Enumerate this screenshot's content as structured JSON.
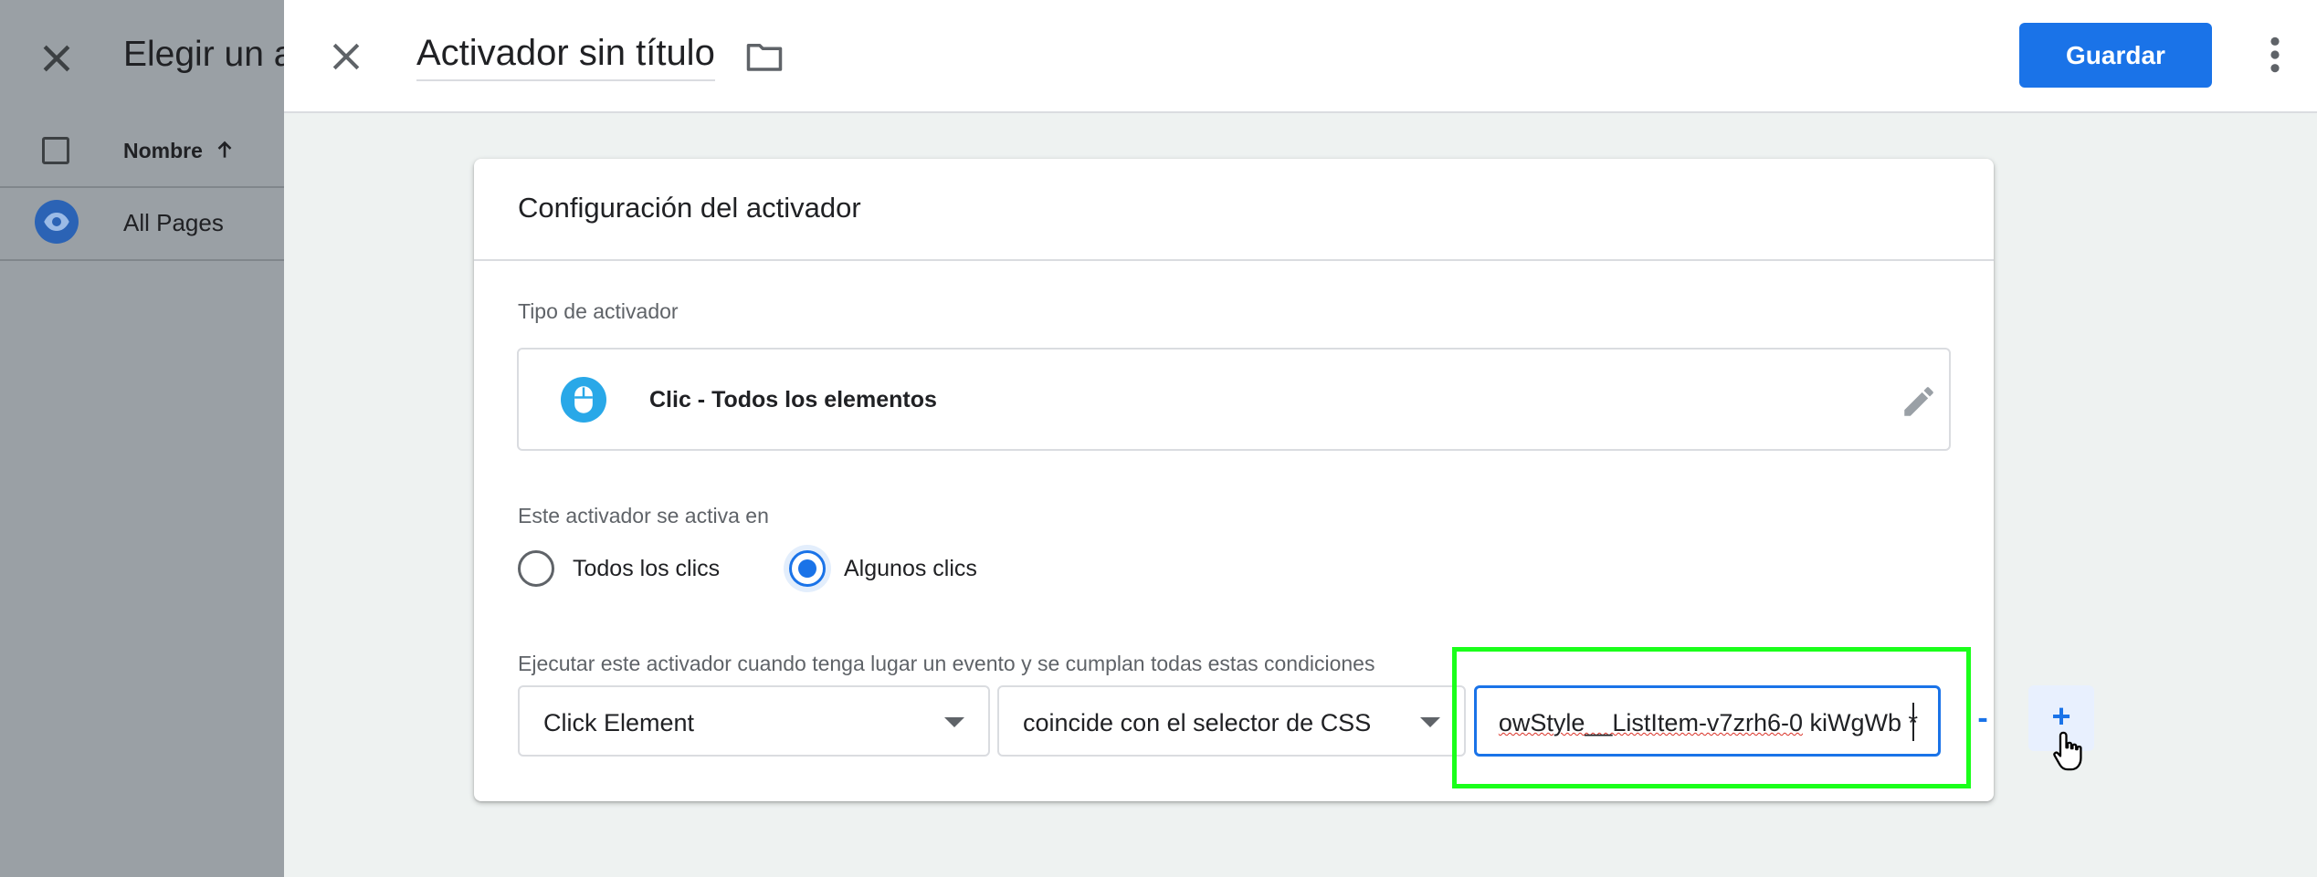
{
  "background_panel": {
    "title": "Elegir un a",
    "column_header": "Nombre",
    "rows": [
      {
        "label": "All Pages"
      }
    ]
  },
  "editor": {
    "trigger_name": "Activador sin título",
    "save_label": "Guardar"
  },
  "config": {
    "title": "Configuración del activador",
    "type_section_label": "Tipo de activador",
    "trigger_type": "Clic - Todos los elementos",
    "fires_on_label": "Este activador se activa en",
    "radio_options": [
      {
        "label": "Todos los clics",
        "checked": false
      },
      {
        "label": "Algunos clics",
        "checked": true
      }
    ],
    "conditions_label": "Ejecutar este activador cuando tenga lugar un evento y se cumplan todas estas condiciones",
    "condition": {
      "variable": "Click Element",
      "operator": "coincide con el selector de CSS",
      "value_visible_prefix": "owStyle__ListItem-v7zrh6-0",
      "value_visible_suffix": " kiWgWb *"
    },
    "remove_symbol": "-",
    "add_symbol": "+"
  },
  "colors": {
    "accent": "#1a73e8",
    "highlight": "#1aff1a",
    "trigger_type_icon": "#29a8e8"
  },
  "icons": [
    "close-icon",
    "folder-icon",
    "more-vert-icon",
    "mouse-icon",
    "pencil-icon",
    "eye-icon",
    "arrow-up-icon",
    "hand-cursor-icon"
  ]
}
